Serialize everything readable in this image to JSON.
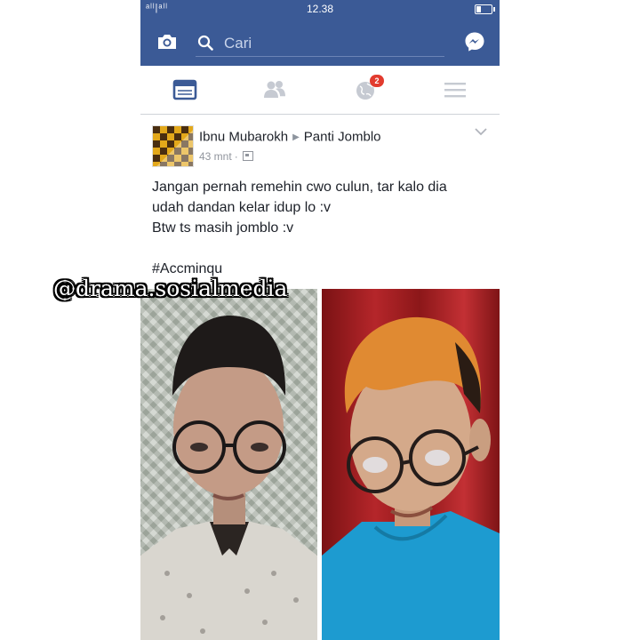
{
  "status_bar": {
    "signal": "ᵃˡˡ|ᵃˡˡ",
    "time": "12.38"
  },
  "header": {
    "search_placeholder": "Cari",
    "icons": [
      "camera-icon",
      "search-icon",
      "messenger-icon"
    ],
    "color": "#3b5a96"
  },
  "tabs": {
    "items": [
      "news-feed-icon",
      "friend-requests-icon",
      "notifications-icon",
      "menu-icon"
    ],
    "notifications_badge": "2",
    "active_color": "#3b5a96"
  },
  "post": {
    "author": "Ibnu Mubarokh",
    "target_group": "Panti Jomblo",
    "time": "43 mnt",
    "lines": [
      "Jangan pernah remehin cwo culun, tar kalo dia",
      "udah dandan kelar idup lo :v",
      "Btw ts masih jomblo :v",
      "",
      "#Accminqu"
    ]
  },
  "watermark": "@drama.sosialmedia"
}
